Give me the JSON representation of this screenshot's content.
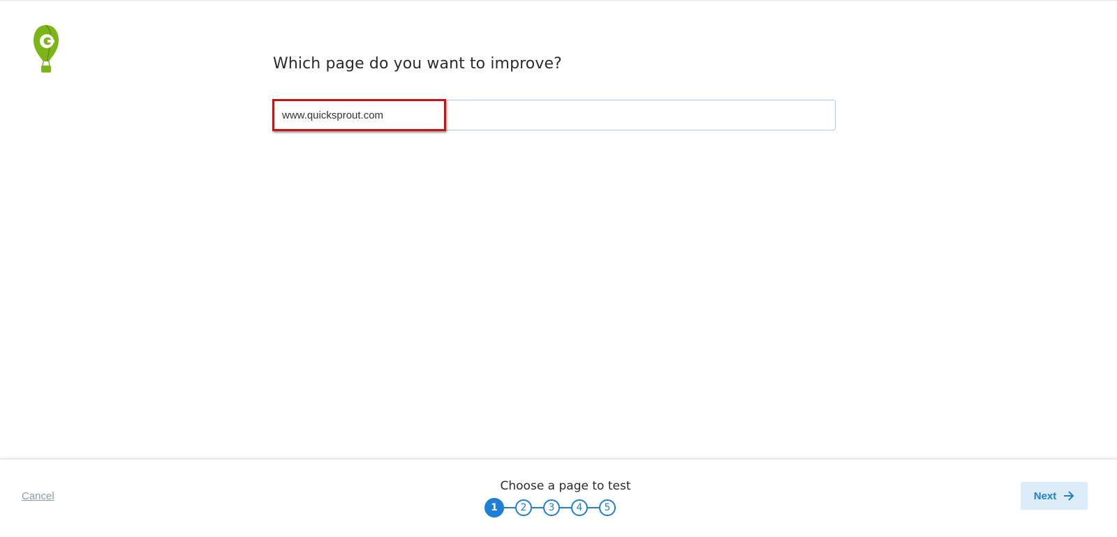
{
  "brand": {
    "logo_icon": "hot-air-balloon-logo-icon",
    "color": "#7cb518"
  },
  "main": {
    "question": "Which page do you want to improve?",
    "url_input_value": "www.quicksprout.com",
    "annotation_color": "#cc1111"
  },
  "footer": {
    "cancel_label": "Cancel",
    "step_label": "Choose a page to test",
    "steps": [
      "1",
      "2",
      "3",
      "4",
      "5"
    ],
    "current_step": 1,
    "next_label": "Next",
    "next_icon": "arrow-right-icon",
    "accent_color": "#1d7fd6"
  }
}
